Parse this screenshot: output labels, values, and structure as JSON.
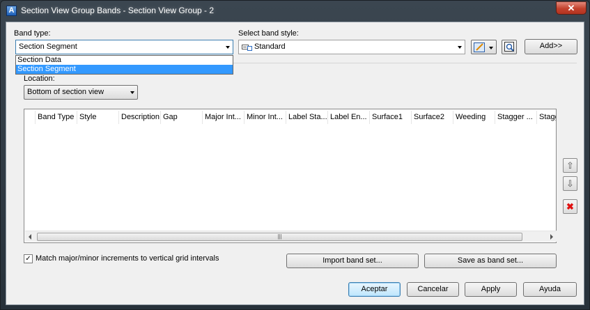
{
  "window": {
    "title": "Section View Group Bands - Section View Group - 2",
    "app_icon": "A",
    "close_glyph": "✕"
  },
  "band_type": {
    "label": "Band type:",
    "value": "Section Segment",
    "options": [
      "Section Data",
      "Section Segment"
    ]
  },
  "band_style": {
    "label": "Select band style:",
    "value": "Standard"
  },
  "add_button": "Add>>",
  "location": {
    "label": "Location:",
    "value": "Bottom of section view"
  },
  "grid": {
    "columns": [
      "Band Type",
      "Style",
      "Description",
      "Gap",
      "Major Int...",
      "Minor Int...",
      "Label Sta...",
      "Label En...",
      "Surface1",
      "Surface2",
      "Weeding",
      "Stagger ...",
      "Stagg"
    ],
    "scroll_grip": "|||"
  },
  "side_buttons": {
    "up": "⇧",
    "down": "⇩",
    "delete": "✖"
  },
  "match_checkbox": {
    "label": "Match major/minor increments to vertical grid intervals",
    "checked_glyph": "✓"
  },
  "import_button": "Import band set...",
  "save_button": "Save as band set...",
  "footer": {
    "ok": "Aceptar",
    "cancel": "Cancelar",
    "apply": "Apply",
    "help": "Ayuda"
  }
}
